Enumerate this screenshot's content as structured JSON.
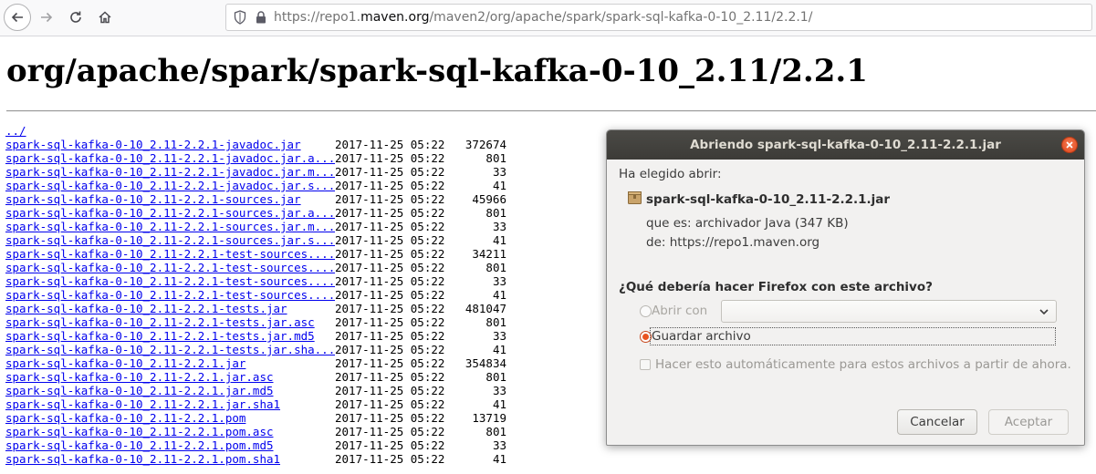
{
  "browser": {
    "url_prefix": "https://repo1.",
    "url_host": "maven.org",
    "url_path": "/maven2/org/apache/spark/spark-sql-kafka-0-10_2.11/2.2.1/",
    "icons": [
      "back-arrow-icon",
      "forward-arrow-icon",
      "reload-icon",
      "home-icon",
      "shield-icon",
      "lock-icon"
    ]
  },
  "page": {
    "title": "org/apache/spark/spark-sql-kafka-0-10_2.11/2.2.1",
    "parent_link": "../",
    "files": [
      {
        "name": "spark-sql-kafka-0-10_2.11-2.2.1-javadoc.jar",
        "date": "2017-11-25 05:22",
        "size": "372674"
      },
      {
        "name": "spark-sql-kafka-0-10_2.11-2.2.1-javadoc.jar.a...",
        "date": "2017-11-25 05:22",
        "size": "801"
      },
      {
        "name": "spark-sql-kafka-0-10_2.11-2.2.1-javadoc.jar.m...",
        "date": "2017-11-25 05:22",
        "size": "33"
      },
      {
        "name": "spark-sql-kafka-0-10_2.11-2.2.1-javadoc.jar.s...",
        "date": "2017-11-25 05:22",
        "size": "41"
      },
      {
        "name": "spark-sql-kafka-0-10_2.11-2.2.1-sources.jar",
        "date": "2017-11-25 05:22",
        "size": "45966"
      },
      {
        "name": "spark-sql-kafka-0-10_2.11-2.2.1-sources.jar.a...",
        "date": "2017-11-25 05:22",
        "size": "801"
      },
      {
        "name": "spark-sql-kafka-0-10_2.11-2.2.1-sources.jar.m...",
        "date": "2017-11-25 05:22",
        "size": "33"
      },
      {
        "name": "spark-sql-kafka-0-10_2.11-2.2.1-sources.jar.s...",
        "date": "2017-11-25 05:22",
        "size": "41"
      },
      {
        "name": "spark-sql-kafka-0-10_2.11-2.2.1-test-sources....",
        "date": "2017-11-25 05:22",
        "size": "34211"
      },
      {
        "name": "spark-sql-kafka-0-10_2.11-2.2.1-test-sources....",
        "date": "2017-11-25 05:22",
        "size": "801"
      },
      {
        "name": "spark-sql-kafka-0-10_2.11-2.2.1-test-sources....",
        "date": "2017-11-25 05:22",
        "size": "33"
      },
      {
        "name": "spark-sql-kafka-0-10_2.11-2.2.1-test-sources....",
        "date": "2017-11-25 05:22",
        "size": "41"
      },
      {
        "name": "spark-sql-kafka-0-10_2.11-2.2.1-tests.jar",
        "date": "2017-11-25 05:22",
        "size": "481047"
      },
      {
        "name": "spark-sql-kafka-0-10_2.11-2.2.1-tests.jar.asc",
        "date": "2017-11-25 05:22",
        "size": "801"
      },
      {
        "name": "spark-sql-kafka-0-10_2.11-2.2.1-tests.jar.md5",
        "date": "2017-11-25 05:22",
        "size": "33"
      },
      {
        "name": "spark-sql-kafka-0-10_2.11-2.2.1-tests.jar.sha...",
        "date": "2017-11-25 05:22",
        "size": "41"
      },
      {
        "name": "spark-sql-kafka-0-10_2.11-2.2.1.jar",
        "date": "2017-11-25 05:22",
        "size": "354834"
      },
      {
        "name": "spark-sql-kafka-0-10_2.11-2.2.1.jar.asc",
        "date": "2017-11-25 05:22",
        "size": "801"
      },
      {
        "name": "spark-sql-kafka-0-10_2.11-2.2.1.jar.md5",
        "date": "2017-11-25 05:22",
        "size": "33"
      },
      {
        "name": "spark-sql-kafka-0-10_2.11-2.2.1.jar.sha1",
        "date": "2017-11-25 05:22",
        "size": "41"
      },
      {
        "name": "spark-sql-kafka-0-10_2.11-2.2.1.pom",
        "date": "2017-11-25 05:22",
        "size": "13719"
      },
      {
        "name": "spark-sql-kafka-0-10_2.11-2.2.1.pom.asc",
        "date": "2017-11-25 05:22",
        "size": "801"
      },
      {
        "name": "spark-sql-kafka-0-10_2.11-2.2.1.pom.md5",
        "date": "2017-11-25 05:22",
        "size": "33"
      },
      {
        "name": "spark-sql-kafka-0-10_2.11-2.2.1.pom.sha1",
        "date": "2017-11-25 05:22",
        "size": "41"
      }
    ]
  },
  "dialog": {
    "title": "Abriendo spark-sql-kafka-0-10_2.11-2.2.1.jar",
    "intro": "Ha elegido abrir:",
    "file_name": "spark-sql-kafka-0-10_2.11-2.2.1.jar",
    "file_type": "que es: archivador Java (347 KB)",
    "file_source": "de: https://repo1.maven.org",
    "question": "¿Qué debería hacer Firefox con este archivo?",
    "open_with_label": "Abrir con",
    "open_with_value": "",
    "save_label": "Guardar archivo",
    "selected_option": "save",
    "auto_label": "Hacer esto automáticamente para estos archivos a partir de ahora.",
    "auto_checked": false,
    "cancel_label": "Cancelar",
    "accept_label": "Aceptar",
    "accent_color": "#e95420"
  }
}
